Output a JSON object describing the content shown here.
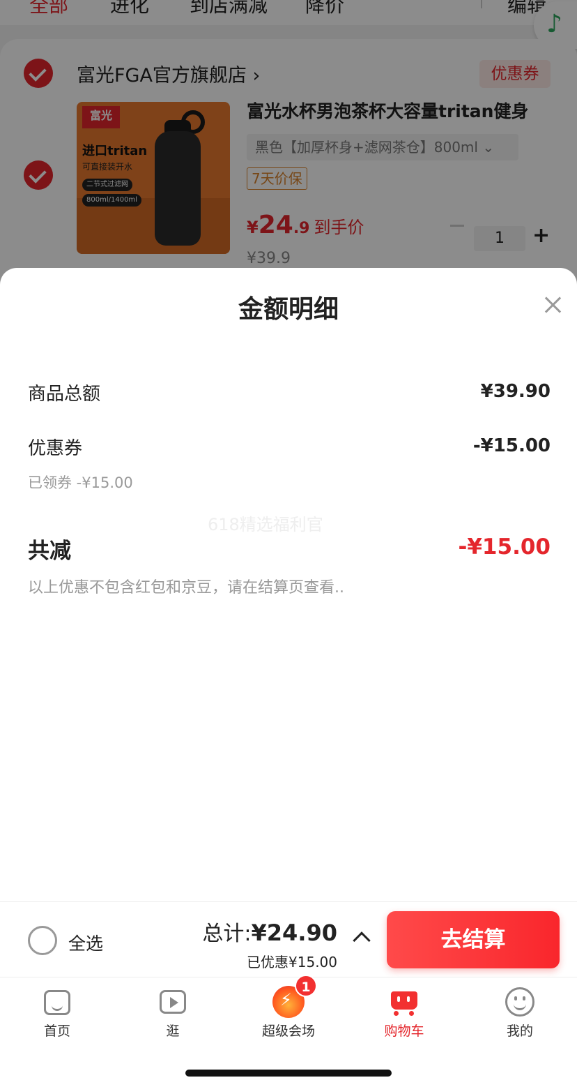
{
  "background": {
    "tabs": [
      "全部",
      "进化",
      "到店满减",
      "降价",
      "编辑"
    ],
    "store": {
      "name": "富光FGA官方旗舰店",
      "coupon_label": "优惠券"
    },
    "product": {
      "image_logo": "富光",
      "image_headline": "进口tritan",
      "image_sub": "可直接装开水",
      "image_chip1": "二节式过滤网",
      "image_chip2": "800ml/1400ml",
      "title": "富光水杯男泡茶杯大容量tritan健身",
      "variant": "黑色【加厚杯身+滤网茶仓】800ml ⌄",
      "guarantee": "7天价保",
      "price_currency": "¥",
      "price_int": "24",
      "price_dec": ".9",
      "price_label": "到手价",
      "original_price": "¥39.9",
      "quantity": "1"
    },
    "music_icon": "♪"
  },
  "sheet": {
    "title": "金额明细",
    "rows": {
      "goods_total_label": "商品总额",
      "goods_total_value": "¥39.90",
      "coupon_label": "优惠券",
      "coupon_value": "-¥15.00",
      "coupon_note": "已领券 -¥15.00"
    },
    "watermark": "618精选福利官",
    "total_reduce_label": "共减",
    "total_reduce_value": "-¥15.00",
    "disclaimer": "以上优惠不包含红包和京豆，请在结算页查看.."
  },
  "checkout": {
    "select_all": "全选",
    "total_label": "总计:",
    "total_amount": "¥24.90",
    "saved_text": "已优惠¥15.00",
    "button": "去结算"
  },
  "tabbar": {
    "items": [
      {
        "label": "首页",
        "icon": "home-icon"
      },
      {
        "label": "逛",
        "icon": "play-icon"
      },
      {
        "label": "超级会场",
        "icon": "fire-icon",
        "badge": "1"
      },
      {
        "label": "购物车",
        "icon": "cart-icon"
      },
      {
        "label": "我的",
        "icon": "smile-icon"
      }
    ],
    "active_index": 3
  },
  "colors": {
    "accent": "#e4262c",
    "music": "#2aa55b"
  }
}
